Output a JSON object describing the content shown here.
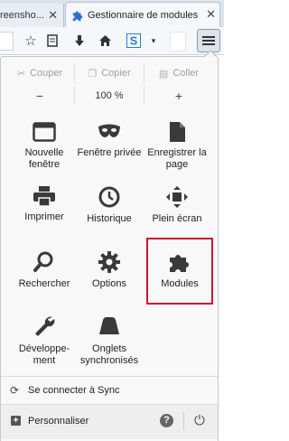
{
  "tabs": [
    {
      "title": "reensho...",
      "close": "✕"
    },
    {
      "title": "Gestionnaire de modules ...",
      "close": "✕"
    }
  ],
  "toolbar": {
    "icons": [
      "bookmark-star-icon",
      "reading-list-icon",
      "download-icon",
      "home-icon",
      "sync-s-icon",
      "dropdown-icon",
      "menu-icon"
    ]
  },
  "edit": {
    "cut": "Couper",
    "copy": "Copier",
    "paste": "Coller"
  },
  "zoom": {
    "minus": "−",
    "level": "100 %",
    "plus": "+"
  },
  "menu_items": {
    "new_window": "Nouvelle fenêtre",
    "private_window": "Fenêtre privée",
    "save_page": "Enregistrer la page",
    "print": "Imprimer",
    "history": "Historique",
    "fullscreen": "Plein écran",
    "search": "Rechercher",
    "options": "Options",
    "addons": "Modules",
    "developer": "Développe-ment",
    "synced_tabs": "Onglets synchronisés"
  },
  "footer": {
    "sync": "Se connecter à Sync",
    "customize": "Personnaliser",
    "help": "?"
  },
  "colors": {
    "highlight": "#c8182e",
    "icon": "#3a3a3a"
  }
}
